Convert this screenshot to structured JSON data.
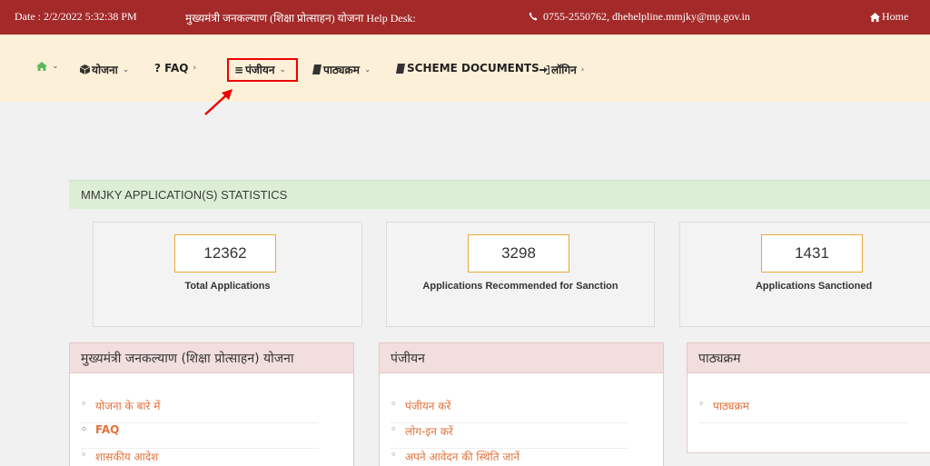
{
  "topbar": {
    "date": "Date : 2/2/2022 5:32:38 PM",
    "title": "मुख्यमंत्री जनकल्याण (शिक्षा प्रोत्साहन) योजना Help Desk:",
    "contact": "0755-2550762, dhehelpline.mmjky@mp.gov.in",
    "home": "Home"
  },
  "nav": {
    "yojana": "योजना",
    "faq": "? FAQ",
    "panjiyan": "पंजीयन",
    "pathyakram": "पाठ्यक्रम",
    "scheme_docs": "SCHEME DOCUMENTS",
    "login": "लॉगिन"
  },
  "stats": {
    "header": "MMJKY APPLICATION(S) STATISTICS",
    "cards": [
      {
        "value": "12362",
        "label": "Total Applications"
      },
      {
        "value": "3298",
        "label": "Applications Recommended for Sanction"
      },
      {
        "value": "1431",
        "label": "Applications Sanctioned"
      }
    ]
  },
  "panels": [
    {
      "title": "मुख्यमंत्री जनकल्याण (शिक्षा प्रोत्साहन) योजना",
      "items": [
        "योजना के बारे में",
        "FAQ",
        "शासकीय आदेश"
      ]
    },
    {
      "title": "पंजीयन",
      "items": [
        "पंजीयन करें",
        "लोग-इन करें",
        "अपने आवेदन की स्थिति जानें"
      ]
    },
    {
      "title": "पाठ्यक्रम",
      "items": [
        "पाठ्यक्रम"
      ]
    }
  ],
  "colors": {
    "topbar": "#a42a2a",
    "navbar": "#fdf0d8",
    "accent_link": "#e2723a",
    "highlight": "#e00000"
  }
}
